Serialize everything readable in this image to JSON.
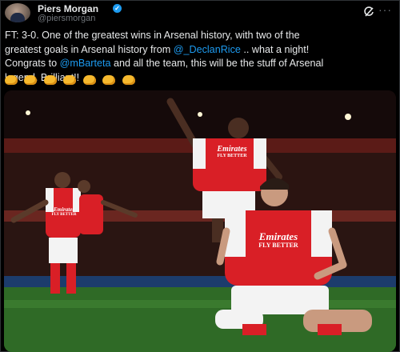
{
  "author": {
    "name": "Piers Morgan",
    "handle": "@piersmorgan",
    "verified_badge": "✓",
    "avatar_icon": "profile-avatar"
  },
  "actions": {
    "grok_icon": "grok-icon",
    "more_label": "···"
  },
  "tweet": {
    "line1": "FT: 3-0. One of the greatest wins in Arsenal history, with two of the",
    "line2_pre": "greatest goals in Arsenal history from ",
    "mention1": "@_DeclanRice",
    "line2_post": " .. what a night!",
    "line3_pre": "Congrats to ",
    "mention2": "@mBarteta",
    "line3_post": " and all the team, this will be the stuff of Arsenal",
    "line4": "legend. Brilliant!!",
    "emojis": [
      "clapping-hands",
      "clapping-hands",
      "clapping-hands",
      "clapping-hands",
      "clapping-hands",
      "clapping-hands",
      "clapping-hands"
    ]
  },
  "photo": {
    "shirt_sponsor": "Emirates",
    "shirt_tagline": "FLY BETTER",
    "colors": {
      "shirt_red": "#d91f26",
      "shirt_white": "#f3f3f3",
      "pitch": "#2f6a26",
      "stand": "#3a1413",
      "link": "#1d9bf0"
    }
  }
}
